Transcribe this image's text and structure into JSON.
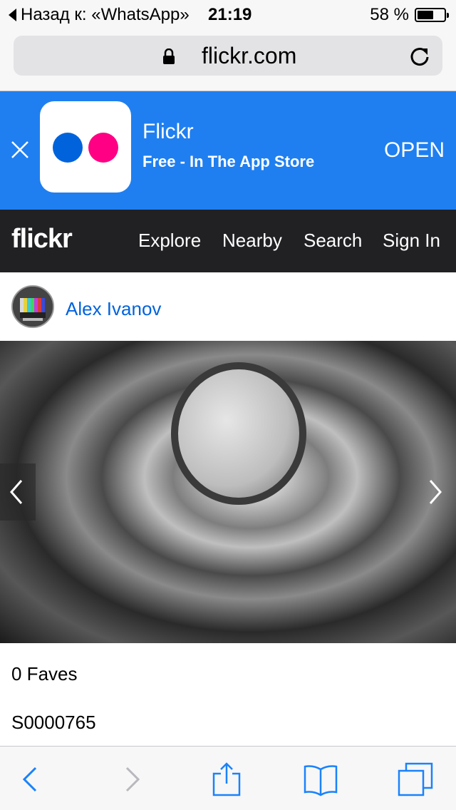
{
  "status_bar": {
    "back_label": "Назад к: «WhatsApp»",
    "time": "21:19",
    "battery_percent": "58 %"
  },
  "url_bar": {
    "url": "flickr.com"
  },
  "app_banner": {
    "title": "Flickr",
    "subtitle": "Free - In The App Store",
    "open_label": "OPEN"
  },
  "nav": {
    "logo": "flickr",
    "links": [
      "Explore",
      "Nearby",
      "Search",
      "Sign In"
    ]
  },
  "author": {
    "name": "Alex Ivanov"
  },
  "photo": {
    "faves": "0 Faves",
    "title": "S0000765"
  },
  "colors": {
    "banner_blue": "#1f7ff0",
    "flickr_blue": "#0063dc",
    "flickr_pink": "#ff0084",
    "nav_dark": "#212124",
    "ios_blue": "#1a82fb"
  },
  "icons": [
    "back-triangle-icon",
    "lock-icon",
    "reload-icon",
    "close-icon",
    "chevron-left-icon",
    "chevron-right-icon",
    "back-icon",
    "forward-icon",
    "share-icon",
    "bookmarks-icon",
    "tabs-icon"
  ]
}
